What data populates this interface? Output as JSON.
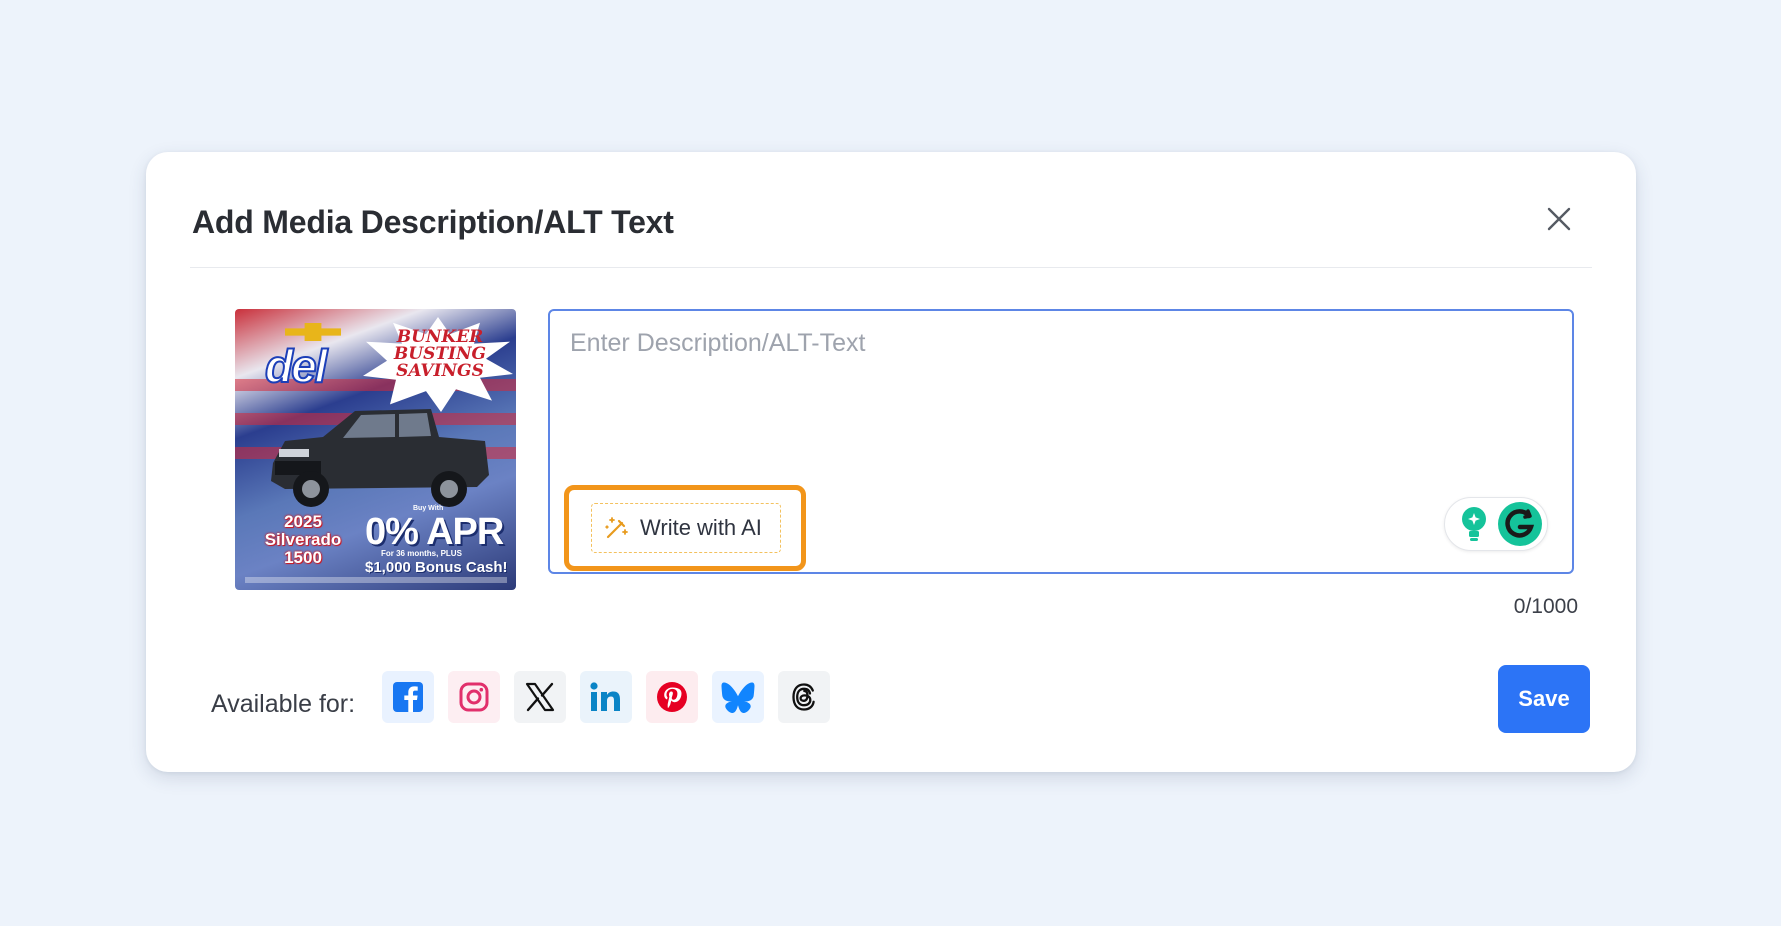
{
  "modal": {
    "title": "Add Media Description/ALT Text",
    "close_icon": "close-icon"
  },
  "thumbnail": {
    "brand": "del",
    "burst_lines": [
      "BUNKER",
      "BUSTING",
      "SAVINGS"
    ],
    "model_lines": [
      "2025",
      "Silverado",
      "1500"
    ],
    "apr_small": "Buy With",
    "apr": "0% APR",
    "apr_sub": "For 36 months, PLUS",
    "bonus": "$1,000 Bonus Cash!"
  },
  "description": {
    "placeholder": "Enter Description/ALT-Text",
    "value": "",
    "ai_button_label": "Write with AI",
    "ai_icon": "magic-wand-icon",
    "char_counter": "0/1000"
  },
  "footer": {
    "available_label": "Available for:",
    "platforms": [
      {
        "name": "facebook",
        "icon": "facebook-icon",
        "bg": "#e9f2ff",
        "color": "#1877f2"
      },
      {
        "name": "instagram",
        "icon": "instagram-icon",
        "bg": "#fdeef2",
        "color": "#e1306c"
      },
      {
        "name": "x",
        "icon": "x-icon",
        "bg": "#f1f3f5",
        "color": "#111111"
      },
      {
        "name": "linkedin",
        "icon": "linkedin-icon",
        "bg": "#eaf3fb",
        "color": "#0a84c6"
      },
      {
        "name": "pinterest",
        "icon": "pinterest-icon",
        "bg": "#fdecef",
        "color": "#e60023"
      },
      {
        "name": "bluesky",
        "icon": "bluesky-icon",
        "bg": "#eaf3ff",
        "color": "#1185fe"
      },
      {
        "name": "threads",
        "icon": "threads-icon",
        "bg": "#f1f3f5",
        "color": "#111111"
      }
    ],
    "save_label": "Save"
  },
  "colors": {
    "accent": "#2c74f6",
    "highlight": "#f2951a",
    "input_border": "#5d86e6"
  }
}
